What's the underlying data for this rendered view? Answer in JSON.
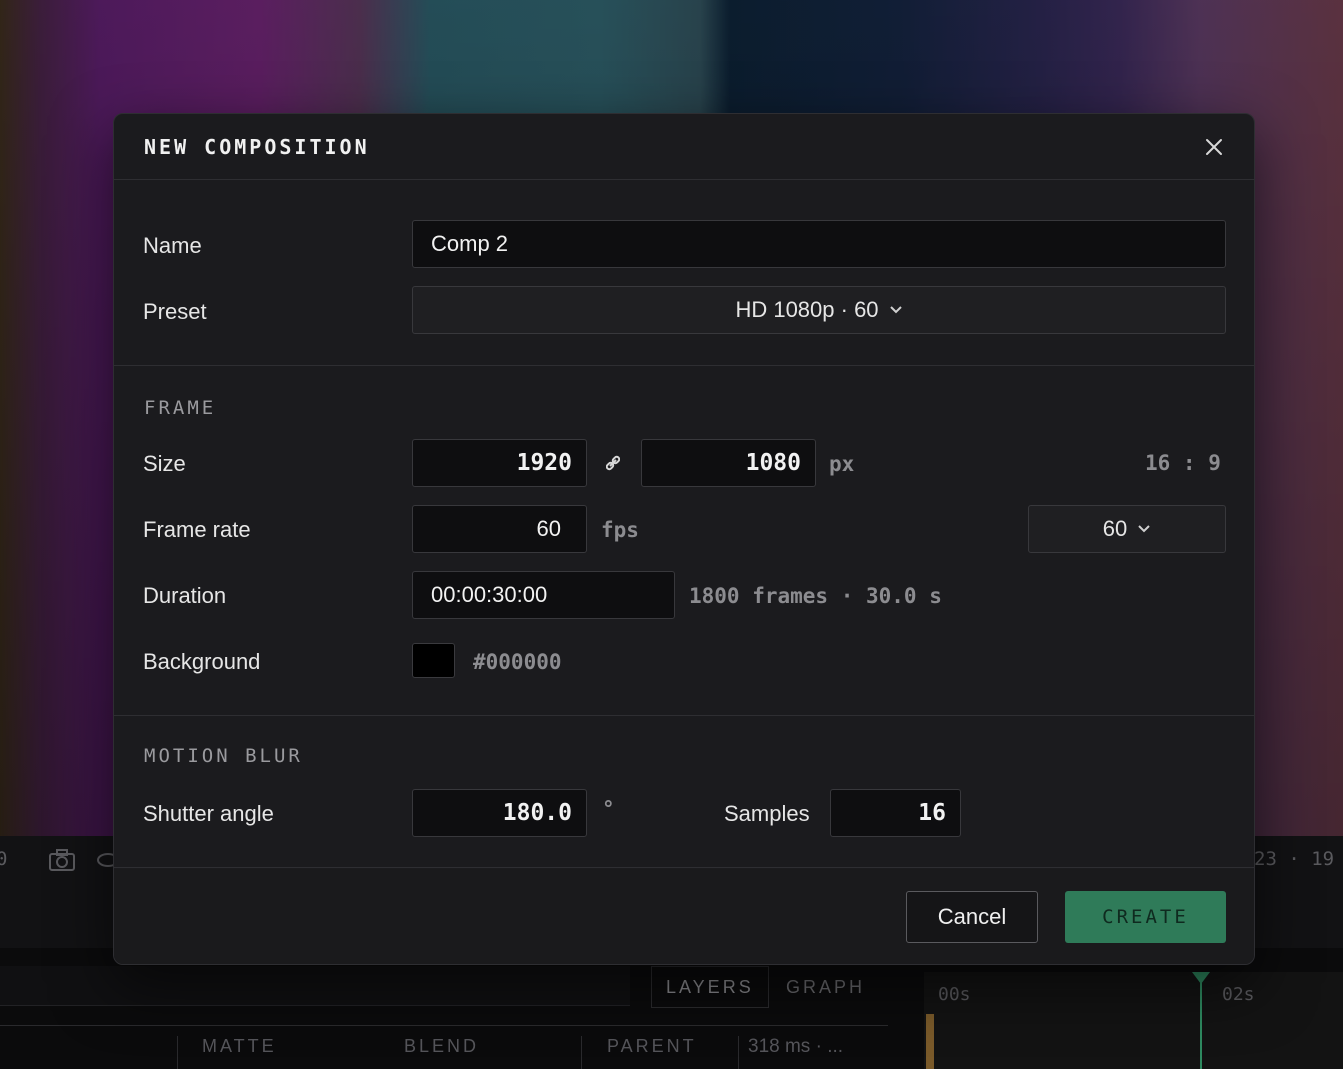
{
  "dialog": {
    "title": "NEW COMPOSITION",
    "close_icon": "close-icon"
  },
  "general": {
    "name_label": "Name",
    "name_value": "Comp 2",
    "preset_label": "Preset",
    "preset_value": "HD 1080p · 60"
  },
  "frame": {
    "heading": "FRAME",
    "size_label": "Size",
    "width": "1920",
    "link_icon": "link-icon",
    "height": "1080",
    "size_unit": "px",
    "aspect": "16 : 9",
    "frame_rate_label": "Frame rate",
    "frame_rate_value": "60",
    "frame_rate_unit": "fps",
    "frame_rate_preset": "60",
    "duration_label": "Duration",
    "duration_value": "00:00:30:00",
    "duration_info": "1800 frames · 30.0 s",
    "background_label": "Background",
    "background_color": "#000000",
    "background_hex": "#000000"
  },
  "motion_blur": {
    "heading": "MOTION BLUR",
    "shutter_label": "Shutter angle",
    "shutter_value": "180.0",
    "shutter_unit": "°",
    "samples_label": "Samples",
    "samples_value": "16"
  },
  "footer": {
    "cancel_label": "Cancel",
    "create_label": "CREATE"
  },
  "background_app": {
    "toolbar_left": "0",
    "toolbar_right": "23 · 19",
    "tabs": [
      "LAYERS",
      "GRAPH"
    ],
    "columns": [
      "MATTE",
      "BLEND",
      "PARENT"
    ],
    "timing": "318 ms · ...",
    "ruler": [
      "00s",
      "02s"
    ],
    "accent_color": "#2f7b59"
  }
}
